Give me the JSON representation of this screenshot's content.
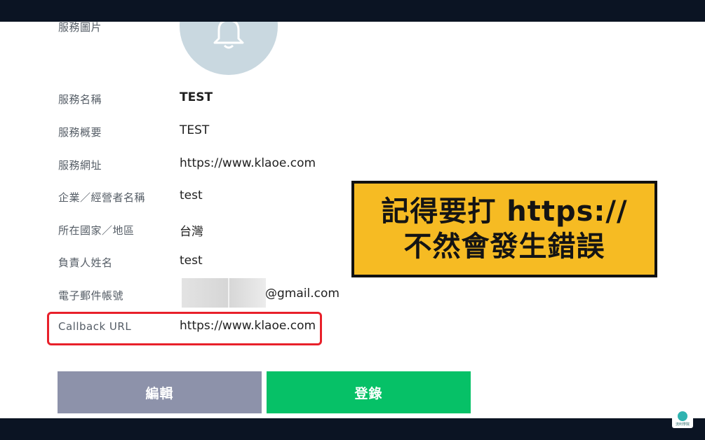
{
  "rows": [
    {
      "label": "服務圖片"
    },
    {
      "label": "服務名稱",
      "value": "TEST"
    },
    {
      "label": "服務概要",
      "value": "TEST"
    },
    {
      "label": "服務網址",
      "value": "https://www.klaoe.com"
    },
    {
      "label": "企業／經營者名稱",
      "value": "test"
    },
    {
      "label": "所在國家／地區",
      "value": "台灣"
    },
    {
      "label": "負責人姓名",
      "value": "test"
    },
    {
      "label": "電子郵件帳號",
      "value": "@gmail.com"
    },
    {
      "label": "Callback URL",
      "value": "https://www.klaoe.com"
    }
  ],
  "buttons": {
    "edit": "編輯",
    "register": "登錄"
  },
  "callout": {
    "line1": "記得要打 https://",
    "line2": "不然會發生錯誤"
  },
  "icons": {
    "service_image": "bell-icon",
    "watermark": "brain-logo-icon"
  },
  "watermark_text": "流利學院",
  "colors": {
    "edit_button": "#8d92aa",
    "register_button": "#06c167",
    "highlight": "#e8202a",
    "callout_bg": "#f6bb23"
  }
}
